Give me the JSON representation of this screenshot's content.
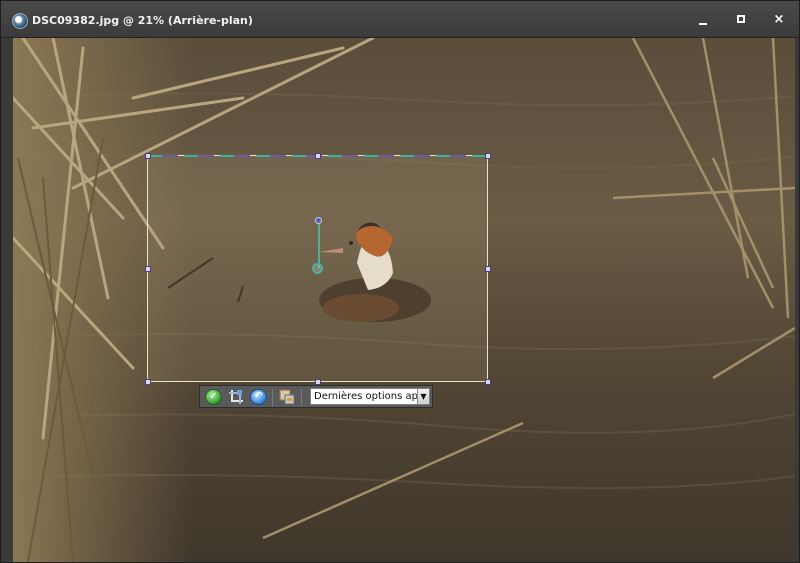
{
  "window": {
    "title": "DSC09382.jpg @  21% (Arrière-plan)",
    "controls": {
      "minimize_icon": "minimize-icon",
      "maximize_icon": "maximize-icon",
      "close_glyph": "×"
    }
  },
  "canvas": {
    "subject": "bird-on-water-photo"
  },
  "crop_toolbar": {
    "commit_icon": "checkmark-icon",
    "commit_glyph": "✓",
    "crop_icon": "crop-tool-icon",
    "cancel_icon": "cancel-undo-icon",
    "cancel_glyph": "↶",
    "straighten_icon": "straighten-icon",
    "options_select_value": "Dernières options app",
    "options_select_arrow": "▼"
  },
  "colors": {
    "titlebar": "#3f3f3f",
    "crop_border": "#e8e6c8",
    "crop_handle": "#4b3e86",
    "rotate_accent": "#47b3a0"
  }
}
